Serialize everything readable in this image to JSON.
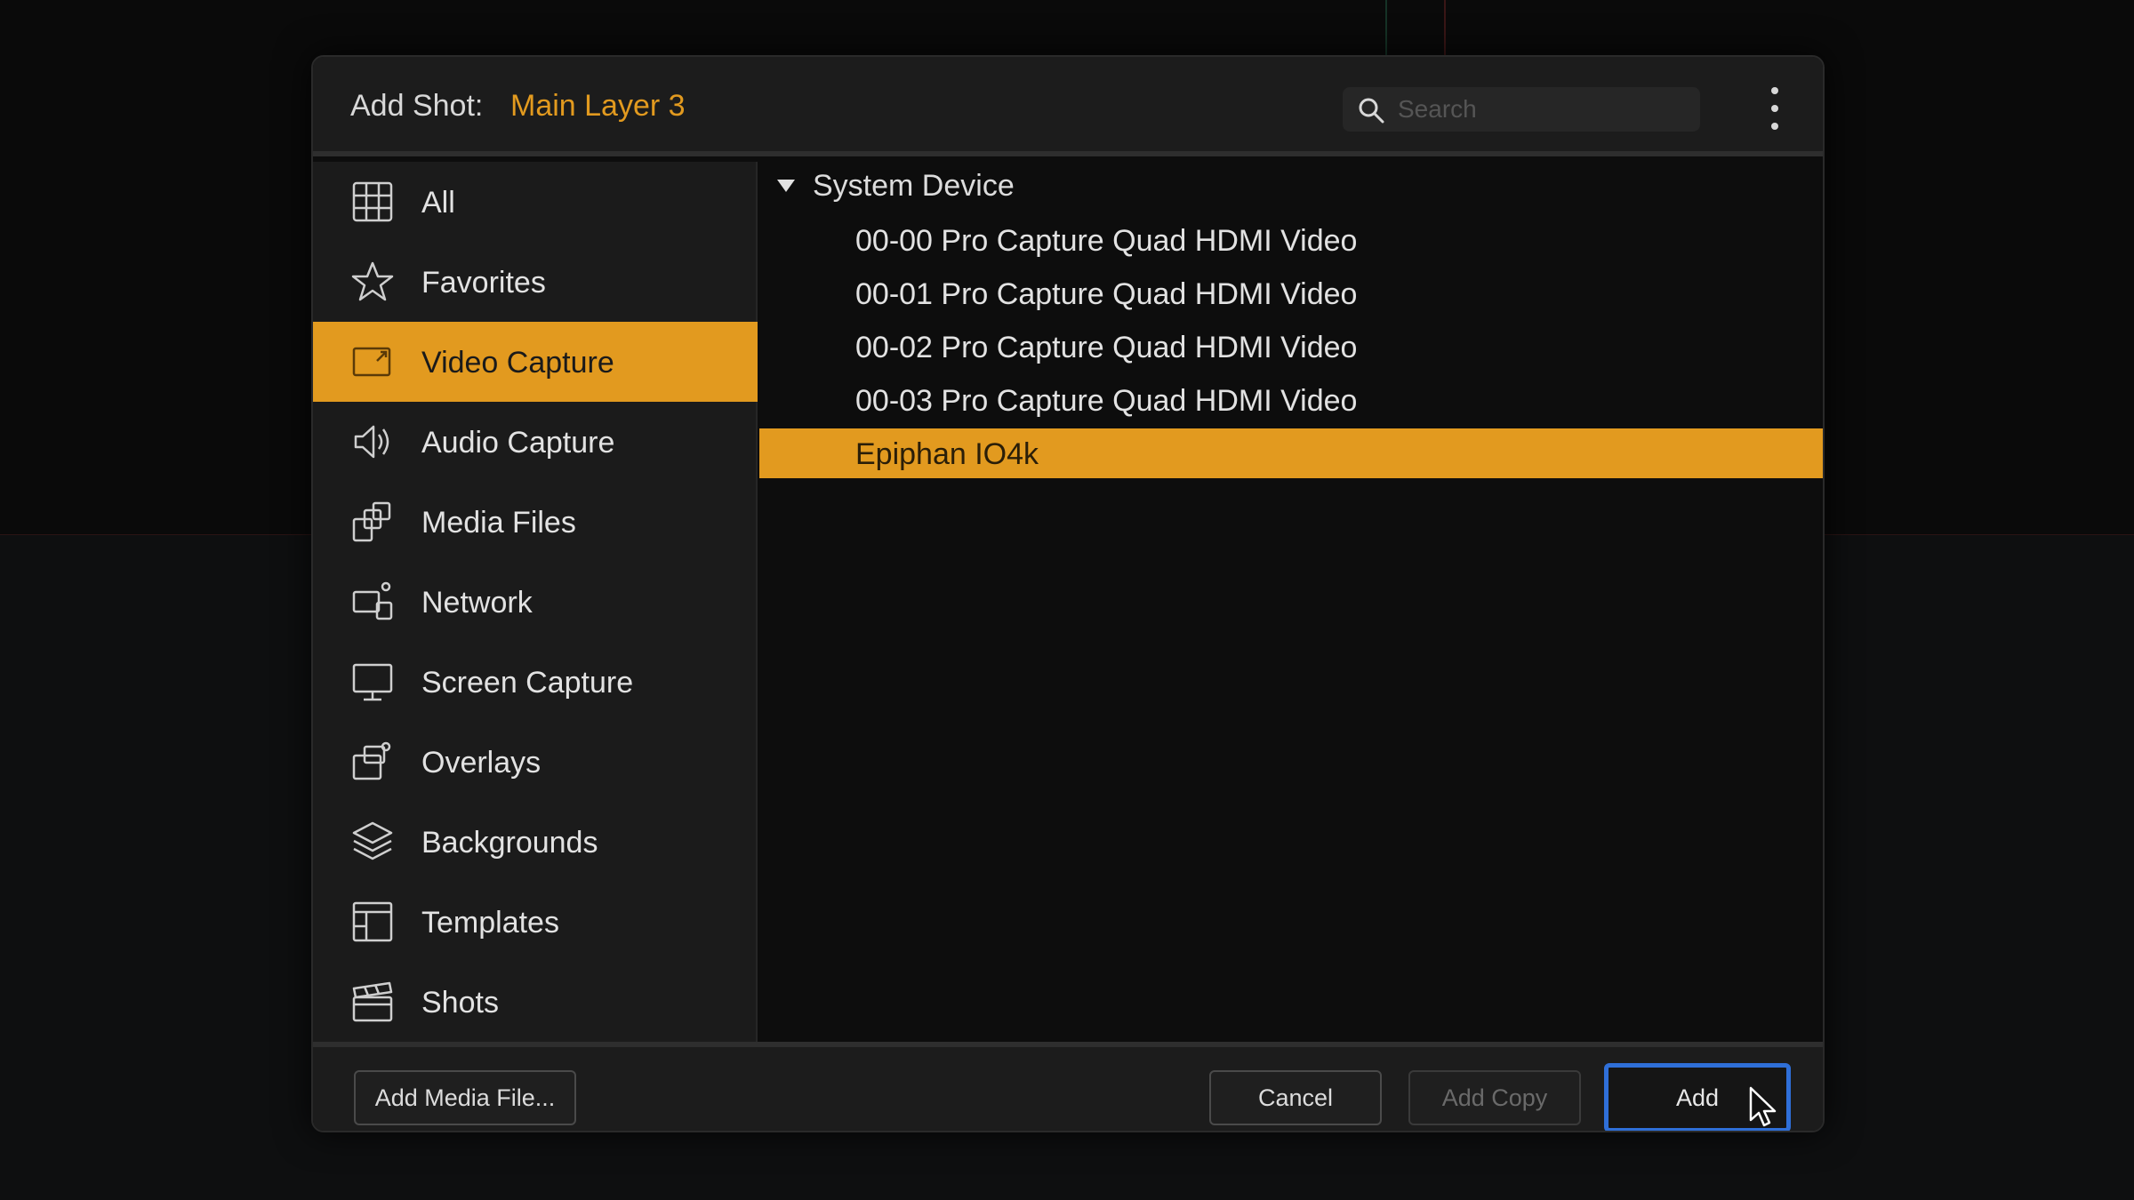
{
  "dialog": {
    "title": "Add Shot:",
    "layer_name": "Main Layer 3",
    "search": {
      "placeholder": "Search",
      "value": ""
    },
    "more_icon": "vertical-ellipsis-icon"
  },
  "sidebar": {
    "items": [
      {
        "label": "All",
        "icon": "grid-icon",
        "active": false
      },
      {
        "label": "Favorites",
        "icon": "star-icon",
        "active": false
      },
      {
        "label": "Video Capture",
        "icon": "video-capture-icon",
        "active": true
      },
      {
        "label": "Audio Capture",
        "icon": "speaker-icon",
        "active": false
      },
      {
        "label": "Media Files",
        "icon": "media-files-icon",
        "active": false
      },
      {
        "label": "Network",
        "icon": "network-icon",
        "active": false
      },
      {
        "label": "Screen Capture",
        "icon": "monitor-icon",
        "active": false
      },
      {
        "label": "Overlays",
        "icon": "overlays-icon",
        "active": false
      },
      {
        "label": "Backgrounds",
        "icon": "layers-icon",
        "active": false
      },
      {
        "label": "Templates",
        "icon": "templates-icon",
        "active": false
      },
      {
        "label": "Shots",
        "icon": "clapperboard-icon",
        "active": false
      }
    ]
  },
  "content": {
    "group": {
      "label": "System Device",
      "expanded": true
    },
    "devices": [
      {
        "label": "00-00 Pro Capture Quad HDMI Video",
        "selected": false
      },
      {
        "label": "00-01 Pro Capture Quad HDMI Video",
        "selected": false
      },
      {
        "label": "00-02 Pro Capture Quad HDMI Video",
        "selected": false
      },
      {
        "label": "00-03 Pro Capture Quad HDMI Video",
        "selected": false
      },
      {
        "label": "Epiphan IO4k",
        "selected": true
      }
    ]
  },
  "footer": {
    "add_media_file": "Add Media File...",
    "cancel": "Cancel",
    "add_copy": "Add Copy",
    "add": "Add"
  },
  "colors": {
    "accent": "#e29a1f",
    "primary_button_border": "#2f6fd8"
  }
}
